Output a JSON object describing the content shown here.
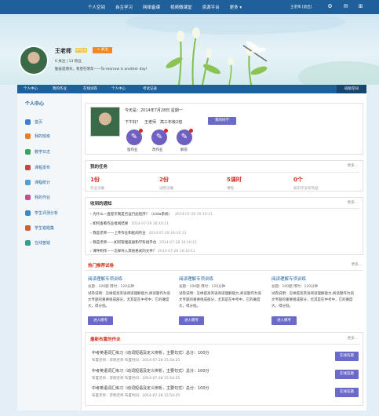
{
  "topnav": {
    "items": [
      "个人空间",
      "自主学习",
      "网络备课",
      "视频微课堂",
      "资源平台",
      "更多 ▾"
    ],
    "user": "王老师 [退出]"
  },
  "profile": {
    "name": "王老师",
    "vip": "VIP会员",
    "follow": "+ 关注",
    "stats": "0 关注 | 13 粉丝",
    "motto": "勤奋是明天，希望在明年——To-morrow is another day!"
  },
  "tabs": [
    "个人中心",
    "我的作业",
    "在线试卷",
    "个人中心",
    "考试记录"
  ],
  "tab_active": "班级空间",
  "sidebar": {
    "title": "个人中心",
    "items": [
      {
        "label": "首页",
        "color": "#3b7fd0"
      },
      {
        "label": "我的班级",
        "color": "#e08030"
      },
      {
        "label": "教学日志",
        "color": "#3aa35a"
      },
      {
        "label": "课程发布",
        "color": "#d04040"
      },
      {
        "label": "课程统计",
        "color": "#4aa0d8"
      },
      {
        "label": "我的作业",
        "color": "#c05090"
      },
      {
        "label": "学生评测分析",
        "color": "#3a88c8"
      },
      {
        "label": "学生错题集",
        "color": "#d06030"
      },
      {
        "label": "在线答疑",
        "color": "#30a090"
      }
    ]
  },
  "welcome": {
    "date": "今天是：2014年7月28日 星期一",
    "greeting": "下午好！",
    "teacher": "王老师",
    "class": "高三年级2班",
    "class_btn": "我的同学",
    "actions": [
      "留作业",
      "改作业",
      "解答"
    ]
  },
  "tasks": {
    "title": "我的任务",
    "more": "更多...",
    "items": [
      {
        "value": "1份",
        "label": "作业没做"
      },
      {
        "value": "2份",
        "label": "试卷没做"
      },
      {
        "value": "5课时",
        "label": "课程"
      },
      {
        "value": "0个",
        "label": "知识点没有巩固"
      }
    ]
  },
  "notices": {
    "title": "收到的通知",
    "more": "更多...",
    "items": [
      {
        "text": "为什么一直提示我是否运行此程序？（vista系统）",
        "date": "2014-07-28 16:10:11"
      },
      {
        "text": "如何查看作业批阅结果",
        "date": "2014-07-28 16:10:11"
      },
      {
        "text": "我是老师——上传作业和批阅作业",
        "date": "2014-07-28 16:10:11"
      },
      {
        "text": "我是老师——如何管理班级和学科组平台",
        "date": "2014-07-28 16:10:11"
      },
      {
        "text": "课件制作——怎样导入其他格式的文件?",
        "date": "2014-07-28 16:10:11"
      }
    ]
  },
  "exams": {
    "title": "热门推荐试卷",
    "more": "更多...",
    "items": [
      {
        "title": "阅读理解专项训练",
        "meta": "总题：100题  用时：120分钟",
        "desc": "试卷说明：怎样提高英语阅读理解能力,阅读题作为语文专题的重要组成部分，尤其是在中考中，它的难度大，得分低。",
        "btn": "进入模考"
      },
      {
        "title": "阅读理解专项训练",
        "meta": "总题：100题  用时：120分钟",
        "desc": "试卷说明：怎样提高英语阅读理解能力,阅读题作为语文专题的重要组成部分，尤其是在中考中，它的难度大，得分低。",
        "btn": "进入模考"
      },
      {
        "title": "阅读理解专项训练",
        "meta": "总题：100题  用时：120分钟",
        "desc": "试卷说明：怎样提高英语阅读理解能力,阅读题作为语文专题的重要组成部分，尤其是在中考中，它的难度大，得分低。",
        "btn": "进入模考"
      }
    ]
  },
  "homework": {
    "title": "最新布置的作业",
    "more": "更多...",
    "items": [
      {
        "title": "中考英语词汇练习（动词短语及定义辨析，主要句式）总分：100分",
        "meta": "布置老师：李明老师  布置时间：2014-07-28 15:54:25",
        "btn": "在线答题"
      },
      {
        "title": "中考英语词汇练习（动词短语及定义辨析，主要句式）总分：100分",
        "meta": "布置老师：李明老师  布置时间：2014-07-28 15:54:25",
        "btn": "在线答题"
      },
      {
        "title": "中考英语词汇练习（动词短语及定义辨析，主要句式）总分：100分",
        "meta": "布置老师：李明老师  布置时间：2014-07-28 15:54:25",
        "btn": "在线答题"
      }
    ]
  }
}
